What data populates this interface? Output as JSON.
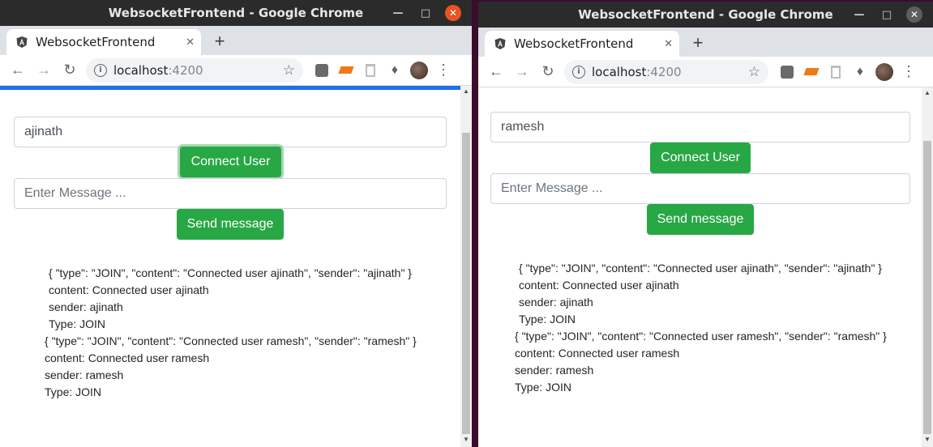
{
  "colors": {
    "accent_button": "#28a745",
    "progress_bar": "#1a73e8",
    "desktop": "#3b0c2c"
  },
  "icons": {
    "favicon": "angular-icon",
    "back": "back-arrow-icon",
    "forward": "forward-arrow-icon",
    "reload": "reload-icon",
    "site_info": "info-icon",
    "bookmark": "star-icon",
    "extensions": "puzzle-icon",
    "menu": "kebab-menu-icon"
  },
  "left": {
    "window_title": "WebsocketFrontend - Google Chrome",
    "tab_title": "WebsocketFrontend",
    "url_host": "localhost",
    "url_port": ":4200",
    "username_value": "ajinath",
    "connect_label": "Connect User",
    "message_placeholder": "Enter Message ...",
    "send_label": "Send message",
    "log": [
      "{ \"type\": \"JOIN\", \"content\": \"Connected user ajinath\", \"sender\": \"ajinath\" }",
      "content: Connected user ajinath",
      "sender: ajinath",
      "Type: JOIN",
      "{ \"type\": \"JOIN\", \"content\": \"Connected user ramesh\", \"sender\": \"ramesh\" }",
      "content: Connected user ramesh",
      "sender: ramesh",
      "Type: JOIN"
    ]
  },
  "right": {
    "window_title": "WebsocketFrontend - Google Chrome",
    "tab_title": "WebsocketFrontend",
    "url_host": "localhost",
    "url_port": ":4200",
    "username_value": "ramesh",
    "connect_label": "Connect User",
    "message_placeholder": "Enter Message ...",
    "send_label": "Send message",
    "log": [
      "{ \"type\": \"JOIN\", \"content\": \"Connected user ajinath\", \"sender\": \"ajinath\" }",
      "content: Connected user ajinath",
      "sender: ajinath",
      "Type: JOIN",
      "{ \"type\": \"JOIN\", \"content\": \"Connected user ramesh\", \"sender\": \"ramesh\" }",
      "content: Connected user ramesh",
      "sender: ramesh",
      "Type: JOIN"
    ]
  }
}
